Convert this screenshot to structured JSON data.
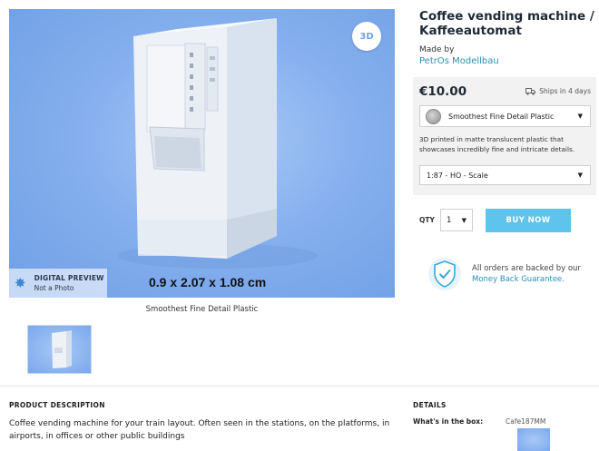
{
  "preview": {
    "badge_3d": "3D",
    "digital_preview_title": "DIGITAL PREVIEW",
    "digital_preview_sub": "Not a Photo",
    "dimensions": "0.9 x 2.07 x 1.08 cm",
    "caption": "Smoothest Fine Detail Plastic"
  },
  "product": {
    "title": "Coffee vending machine / Kaffeeautomat",
    "made_by_label": "Made by",
    "maker": "PetrOs Modellbau",
    "price": "€10.00",
    "ships": "Ships in 4 days",
    "material": "Smoothest Fine Detail Plastic",
    "material_description": "3D printed in matte translucent plastic that showcases incredibly fine and intricate details.",
    "scale": "1:87 - HO - Scale",
    "qty_label": "QTY",
    "qty_value": "1",
    "buy_label": "BUY NOW",
    "guarantee_text": "All orders are backed by our",
    "guarantee_link": "Money Back Guarantee."
  },
  "description": {
    "title": "PRODUCT DESCRIPTION",
    "text": "Coffee vending machine for your train layout. Often seen in the stations, on the platforms, in airports, in offices or other public buildings"
  },
  "details": {
    "title": "DETAILS",
    "in_box_label": "What's in the box:",
    "in_box_value": "Cafe187MM"
  },
  "colors": {
    "accent": "#5ec3ed",
    "link": "#2b8fb3",
    "preview_bg": "#86b0ee"
  }
}
